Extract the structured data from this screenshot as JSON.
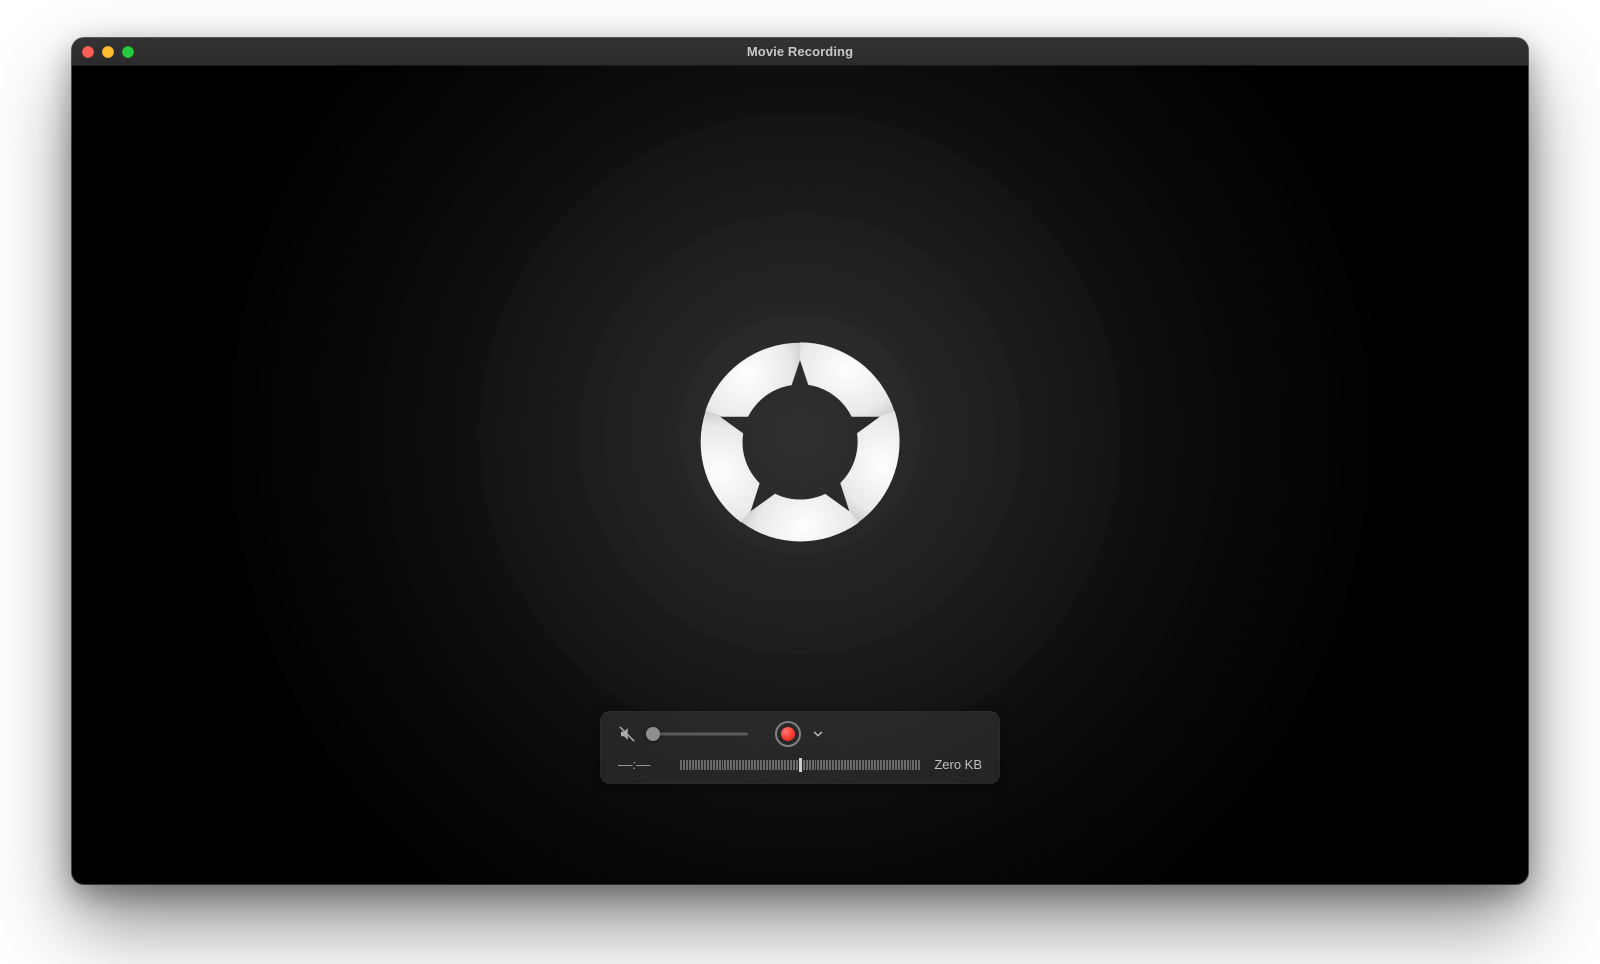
{
  "window": {
    "title": "Movie Recording"
  },
  "traffic_lights": {
    "close": "close",
    "minimize": "minimize",
    "zoom": "zoom"
  },
  "controls": {
    "mute_icon": "volume-muted-icon",
    "volume": 0,
    "record_label": "Record",
    "options_label": "Recording options"
  },
  "status": {
    "time": "––:––",
    "filesize": "Zero KB"
  }
}
